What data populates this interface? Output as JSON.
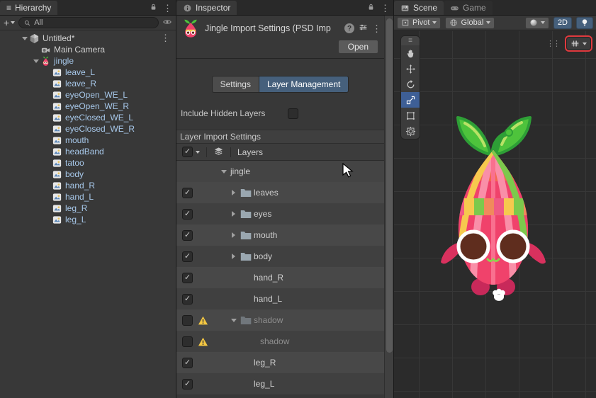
{
  "icons": {
    "kebab": "⋮",
    "menu": "≡",
    "check": "✓",
    "drag_dots": "⋮⋮"
  },
  "colors": {
    "panel_bg": "#383838",
    "strip_bg": "#292929",
    "accent_blue": "#46607C",
    "selection_blue": "#3E5F96",
    "warning_yellow": "#F5C842",
    "prefab_text": "#A7C8EA",
    "character_pink": "#F0426B",
    "leaf_green": "#4EC33C"
  },
  "hierarchy": {
    "tab_label": "Hierarchy",
    "add_button": "+",
    "search_value": "All",
    "items": [
      {
        "label": "Untitled*",
        "icon": "unity",
        "depth": 0,
        "foldout": "open",
        "kebab": true
      },
      {
        "label": "Main Camera",
        "icon": "camera",
        "depth": 1
      },
      {
        "label": "jingle",
        "icon": "jingle",
        "depth": 1,
        "foldout": "open",
        "prefab": true
      },
      {
        "label": "leave_L",
        "icon": "sprite",
        "depth": 2,
        "prefab": true
      },
      {
        "label": "leave_R",
        "icon": "sprite",
        "depth": 2,
        "prefab": true
      },
      {
        "label": "eyeOpen_WE_L",
        "icon": "sprite",
        "depth": 2,
        "prefab": true
      },
      {
        "label": "eyeOpen_WE_R",
        "icon": "sprite",
        "depth": 2,
        "prefab": true
      },
      {
        "label": "eyeClosed_WE_L",
        "icon": "sprite",
        "depth": 2,
        "prefab": true
      },
      {
        "label": "eyeClosed_WE_R",
        "icon": "sprite",
        "depth": 2,
        "prefab": true
      },
      {
        "label": "mouth",
        "icon": "sprite",
        "depth": 2,
        "prefab": true
      },
      {
        "label": "headBand",
        "icon": "sprite",
        "depth": 2,
        "prefab": true
      },
      {
        "label": "tatoo",
        "icon": "sprite",
        "depth": 2,
        "prefab": true
      },
      {
        "label": "body",
        "icon": "sprite",
        "depth": 2,
        "prefab": true
      },
      {
        "label": "hand_R",
        "icon": "sprite",
        "depth": 2,
        "prefab": true
      },
      {
        "label": "hand_L",
        "icon": "sprite",
        "depth": 2,
        "prefab": true
      },
      {
        "label": "leg_R",
        "icon": "sprite",
        "depth": 2,
        "prefab": true
      },
      {
        "label": "leg_L",
        "icon": "sprite",
        "depth": 2,
        "prefab": true
      }
    ]
  },
  "inspector": {
    "tab_label": "Inspector",
    "title": "Jingle Import Settings (PSD Imp",
    "open_button": "Open",
    "tabs": [
      {
        "label": "Settings",
        "active": false
      },
      {
        "label": "Layer Management",
        "active": true
      }
    ],
    "include_hidden_label": "Include Hidden Layers",
    "include_hidden_checked": false,
    "section_title": "Layer Import Settings",
    "layers_header": "Layers",
    "header_checked": true,
    "rows": [
      {
        "label": "jingle",
        "kind": "root",
        "foldout": "open"
      },
      {
        "label": "leaves",
        "checked": true,
        "folder": true,
        "foldout": "closed"
      },
      {
        "label": "eyes",
        "checked": true,
        "folder": true,
        "foldout": "closed"
      },
      {
        "label": "mouth",
        "checked": true,
        "folder": true,
        "foldout": "closed"
      },
      {
        "label": "body",
        "checked": true,
        "folder": true,
        "foldout": "closed"
      },
      {
        "label": "hand_R",
        "checked": true
      },
      {
        "label": "hand_L",
        "checked": true
      },
      {
        "label": "shadow",
        "checked": false,
        "warning": true,
        "folder": true,
        "foldout": "open",
        "dim": true
      },
      {
        "label": "shadow",
        "checked": false,
        "warning": true,
        "dim": true,
        "indent": 1
      },
      {
        "label": "leg_R",
        "checked": true
      },
      {
        "label": "leg_L",
        "checked": true
      }
    ]
  },
  "scene": {
    "tabs": [
      {
        "label": "Scene",
        "active": true
      },
      {
        "label": "Game",
        "active": false
      }
    ],
    "toolbar": {
      "pivot_label": "Pivot",
      "global_label": "Global",
      "mode_2d_label": "2D"
    }
  }
}
